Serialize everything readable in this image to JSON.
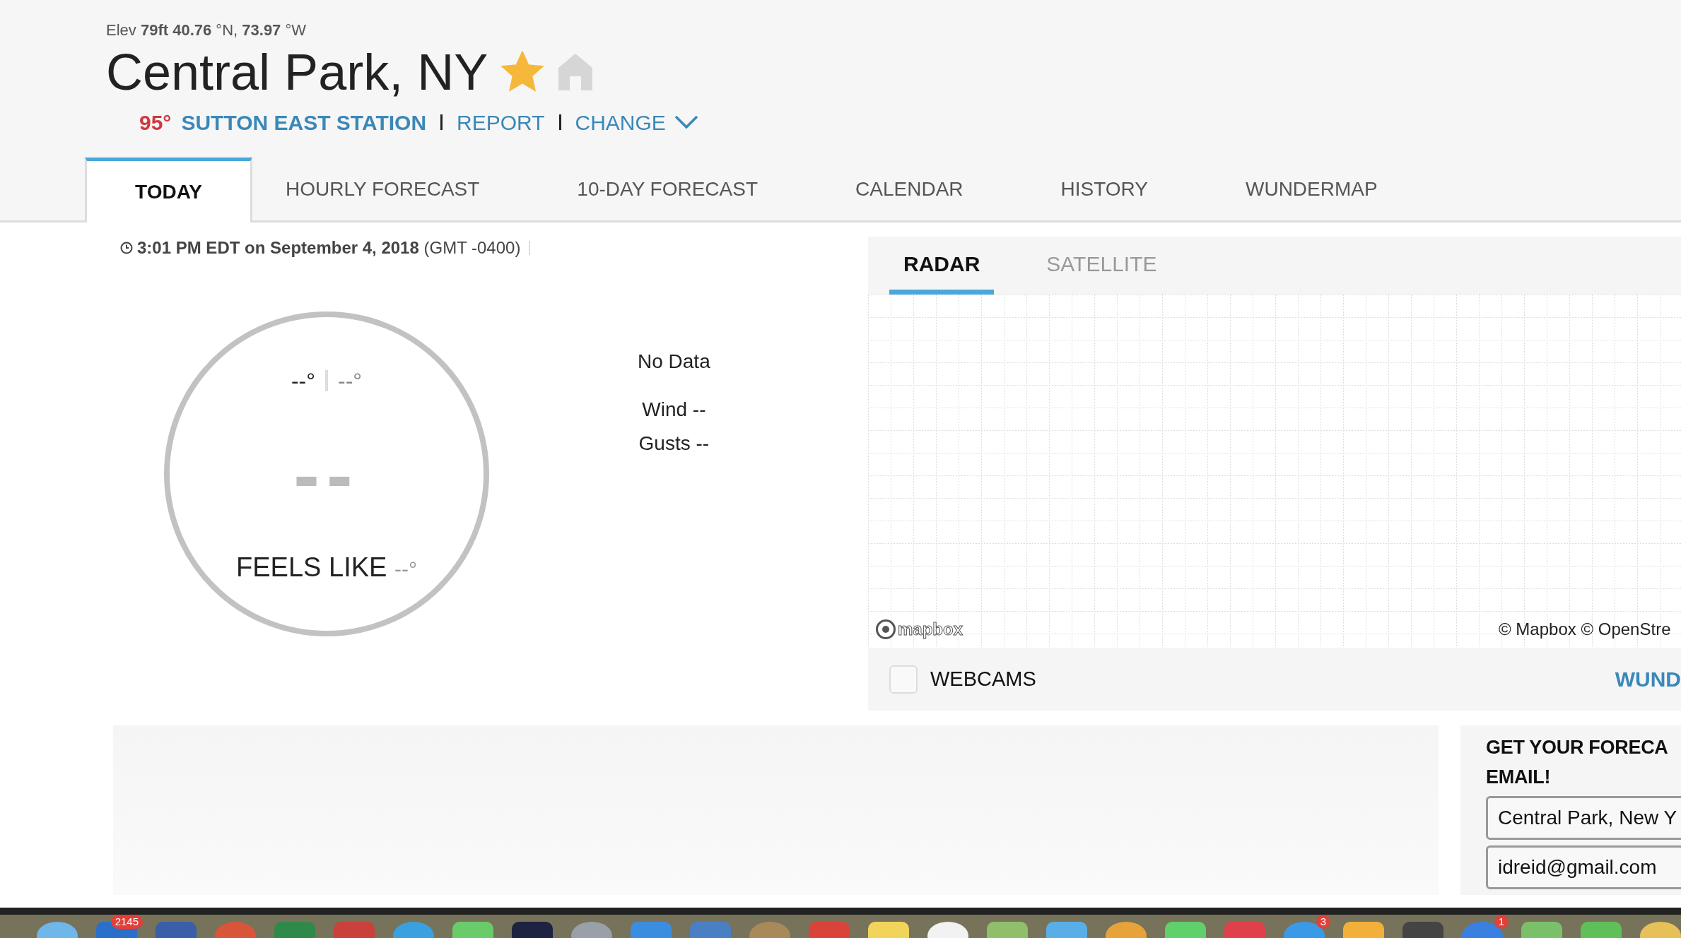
{
  "header": {
    "elev_label": "Elev",
    "elev_value": "79ft",
    "lat": "40.76",
    "lat_unit": "°N,",
    "lon": "73.97",
    "lon_unit": "°W",
    "title": "Central Park, NY",
    "favorite": true,
    "station_temp": "95°",
    "station_name": "SUTTON EAST STATION",
    "report": "REPORT",
    "change": "CHANGE"
  },
  "tabs": [
    {
      "label": "TODAY",
      "selected": true
    },
    {
      "label": "HOURLY FORECAST",
      "selected": false
    },
    {
      "label": "10-DAY FORECAST",
      "selected": false
    },
    {
      "label": "CALENDAR",
      "selected": false
    },
    {
      "label": "HISTORY",
      "selected": false
    },
    {
      "label": "WUNDERMAP",
      "selected": false
    }
  ],
  "observed": {
    "time": "3:01 PM EDT on September 4, 2018",
    "zone": "(GMT -0400)"
  },
  "conditions": {
    "high": "--°",
    "low": "--°",
    "temp": "--",
    "feels_label": "FEELS LIKE",
    "feels_value": "--°",
    "summary": "No Data",
    "wind": "Wind --",
    "gusts": "Gusts --"
  },
  "map": {
    "tabs": [
      {
        "label": "RADAR",
        "selected": true
      },
      {
        "label": "SATELLITE",
        "selected": false
      }
    ],
    "logo": "mapbox",
    "attribution": "© Mapbox © OpenStre",
    "webcams": {
      "label": "WEBCAMS",
      "checked": false
    },
    "link": "WUND"
  },
  "email_signup": {
    "heading": "GET YOUR FORECA EMAIL!",
    "location": "Central Park, New Y",
    "email": "idreid@gmail.com"
  },
  "dock": [
    {
      "kind": "app"
    },
    {
      "kind": "app",
      "badge": "2145"
    },
    {
      "kind": "app"
    },
    {
      "kind": "app"
    },
    {
      "kind": "app"
    },
    {
      "kind": "app"
    },
    {
      "kind": "app"
    },
    {
      "kind": "app"
    },
    {
      "kind": "app"
    },
    {
      "kind": "app"
    },
    {
      "kind": "app"
    },
    {
      "kind": "app"
    },
    {
      "kind": "app"
    },
    {
      "kind": "app"
    },
    {
      "kind": "app"
    },
    {
      "kind": "app"
    },
    {
      "kind": "app"
    },
    {
      "kind": "app"
    },
    {
      "kind": "app"
    },
    {
      "kind": "app"
    },
    {
      "kind": "app"
    },
    {
      "kind": "app",
      "badge": "3"
    },
    {
      "kind": "app"
    },
    {
      "kind": "app"
    },
    {
      "kind": "app",
      "badge": "1"
    },
    {
      "kind": "app"
    },
    {
      "kind": "app"
    },
    {
      "kind": "app"
    }
  ]
}
